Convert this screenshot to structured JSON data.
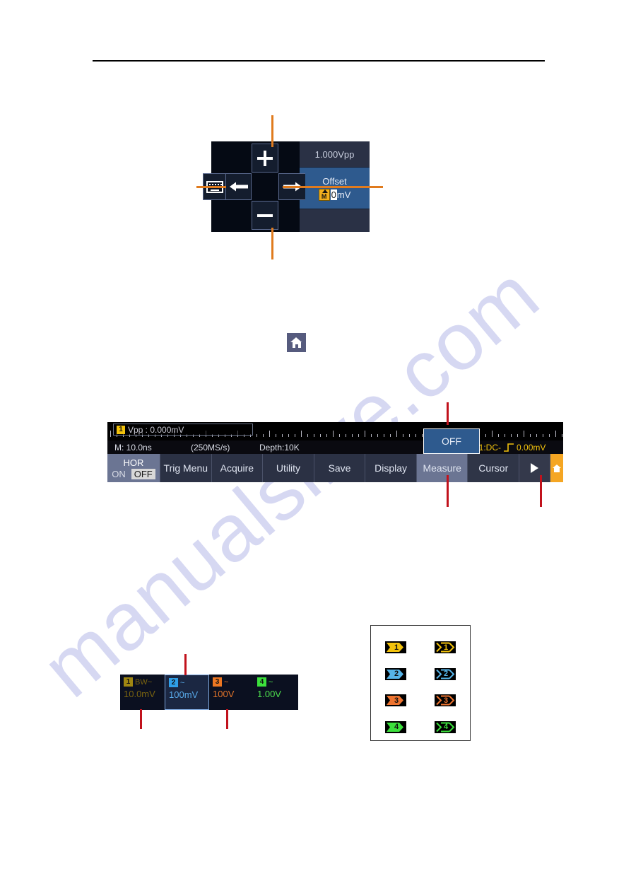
{
  "page": {
    "watermark": "manualslive.com"
  },
  "keypad_figure": {
    "buttons": {
      "plus": "+",
      "minus": "-",
      "left": "left-arrow",
      "right": "right-arrow",
      "keyboard": "keyboard"
    },
    "side_panel": {
      "amplitude": "1.000Vpp",
      "offset_label": "Offset",
      "offset_badge_letter": "M",
      "offset_value": "0",
      "offset_unit": "mV"
    }
  },
  "home_icon": {
    "name": "home"
  },
  "scope_figure": {
    "measure_box": {
      "channel": "1",
      "text": "Vpp : 0.000mV"
    },
    "status": {
      "timebase": "M: 10.0ns",
      "sample_rate": "(250MS/s)",
      "depth": "Depth:10K",
      "trigger_prefix": "H1:DC-",
      "trigger_level": "0.00mV"
    },
    "popup": {
      "label": "OFF"
    },
    "menu": {
      "hor_title": "HOR",
      "hor_on": "ON",
      "hor_off": "OFF",
      "items": [
        "Trig Menu",
        "Acquire",
        "Utility",
        "Save",
        "Display",
        "Measure",
        "Cursor"
      ],
      "next_arrow": "next-page-arrow",
      "home": "home"
    }
  },
  "channels_figure": {
    "channels": [
      {
        "num": "1",
        "mode": "BW~",
        "value": "10.0mV",
        "color": "#7a6410",
        "num_bg": "#a08712",
        "selected": false
      },
      {
        "num": "2",
        "mode": "~",
        "value": "100mV",
        "color": "#58a8e8",
        "num_bg": "#2f9fe8",
        "selected": true
      },
      {
        "num": "3",
        "mode": "~",
        "value": "100V",
        "color": "#e2742a",
        "num_bg": "#ee7722",
        "selected": false
      },
      {
        "num": "4",
        "mode": "~",
        "value": "1.00V",
        "color": "#4ee04e",
        "num_bg": "#3ce03c",
        "selected": false
      }
    ]
  },
  "legend_figure": {
    "markers": [
      {
        "num": "1",
        "color": "#f2c20c",
        "filled": true
      },
      {
        "num": "1",
        "color": "#f2c20c",
        "filled": false
      },
      {
        "num": "2",
        "color": "#56b4e8",
        "filled": true
      },
      {
        "num": "2",
        "color": "#56b4e8",
        "filled": false
      },
      {
        "num": "3",
        "color": "#ee7430",
        "filled": true
      },
      {
        "num": "3",
        "color": "#ee7430",
        "filled": false
      },
      {
        "num": "4",
        "color": "#3ce03c",
        "filled": true
      },
      {
        "num": "4",
        "color": "#3ce03c",
        "filled": false
      }
    ]
  },
  "colors": {
    "callout_orange": "#e07b1e",
    "callout_red": "#c1121c",
    "scope_selected": "#6b7593",
    "scope_menu_bg": "#2b3144",
    "offset_highlight": "#2e5a8e"
  }
}
